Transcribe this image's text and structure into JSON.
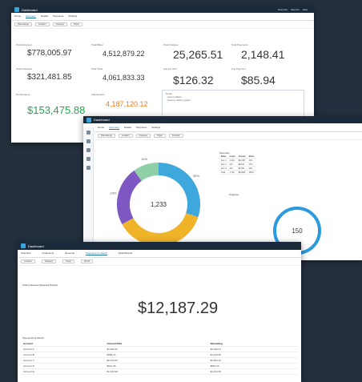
{
  "window1": {
    "app": "Dashboard",
    "topbar_links": [
      "Overview",
      "Reports",
      "Help"
    ],
    "tabs": [
      "Home",
      "Summary",
      "Details",
      "Payments",
      "Settings"
    ],
    "filters": [
      "Date Range",
      "Location",
      "Category",
      "Payer"
    ],
    "metrics": [
      {
        "label": "Total Expected",
        "value": "$778,005.97"
      },
      {
        "label": "Total Billed",
        "value": "4,512,879.22"
      },
      {
        "label": "Total Charges",
        "value": "25,265.51"
      },
      {
        "label": "Total Payments",
        "value": "2,148.41"
      },
      {
        "label": "Total Collected",
        "value": "$321,481.85"
      },
      {
        "label": "Total Visits",
        "value": "4,061,833.33"
      },
      {
        "label": "Avg per Visit",
        "value": "$126.32"
      },
      {
        "label": "Avg Payment",
        "value": "$85.94"
      },
      {
        "label": "Net Revenue",
        "value": "$153,475.88",
        "color": "#21a84a"
      },
      {
        "label": "Adjustments",
        "value": "4,187,120.12",
        "color": "#f07a1a"
      }
    ],
    "note_lines": [
      "Notes",
      "Last updated",
      "Source: billing system"
    ]
  },
  "window2": {
    "app": "Dashboard",
    "tabs": [
      "Home",
      "Summary",
      "Details",
      "Payments",
      "Settings"
    ],
    "filters": [
      "Date Range",
      "Location",
      "Category",
      "Payer",
      "Provider"
    ],
    "donut": {
      "center_label": "1,233",
      "segments": [
        {
          "label": "Segment A",
          "value": 30,
          "color": "#3ea8dc"
        },
        {
          "label": "Segment B",
          "value": 37,
          "color": "#f0b429"
        },
        {
          "label": "Segment C",
          "value": 23,
          "color": "#7e57c2"
        },
        {
          "label": "Segment D",
          "value": 10,
          "color": "#8fd0a9"
        }
      ],
      "slice_labels": [
        "30%",
        "37%",
        "23%",
        "10%"
      ]
    },
    "table_title": "Summary",
    "table_headers": [
      "Name",
      "Count",
      "Amount",
      "Share"
    ],
    "table_rows": [
      [
        "Item 1",
        "1,024",
        "$12,400",
        "41%"
      ],
      [
        "Item 2",
        "512",
        "$8,100",
        "27%"
      ],
      [
        "Item 3",
        "210",
        "$4,300",
        "14%"
      ],
      [
        "Total",
        "1,746",
        "$24,800",
        "100%"
      ]
    ],
    "gauge_title": "Progress",
    "gauge_value": "150",
    "gauge_color": "#2b9adf"
  },
  "window3": {
    "app": "Dashboard",
    "top_tabs": [
      "Overview",
      "Collections",
      "Revenue",
      "Payments by Month",
      "Detail Report"
    ],
    "active_tab_index": 3,
    "filters": [
      "Location",
      "Category",
      "Payer",
      "Month"
    ],
    "section_title": "Total Collected (Selected Period)",
    "big_value": "$12,187.29",
    "table_title": "Payments by Month",
    "table_headers": [
      "Account",
      "Amount Paid",
      "Remaining"
    ],
    "table_rows": [
      [
        "Account A",
        "$1,202.22",
        "$2,340.41"
      ],
      [
        "Account B",
        "$980.15",
        "$1,120.30"
      ],
      [
        "Account C",
        "$2,410.00",
        "$3,004.12"
      ],
      [
        "Account D",
        "$612.45",
        "$801.10"
      ],
      [
        "Account E",
        "$1,333.90",
        "$1,412.55"
      ]
    ]
  }
}
